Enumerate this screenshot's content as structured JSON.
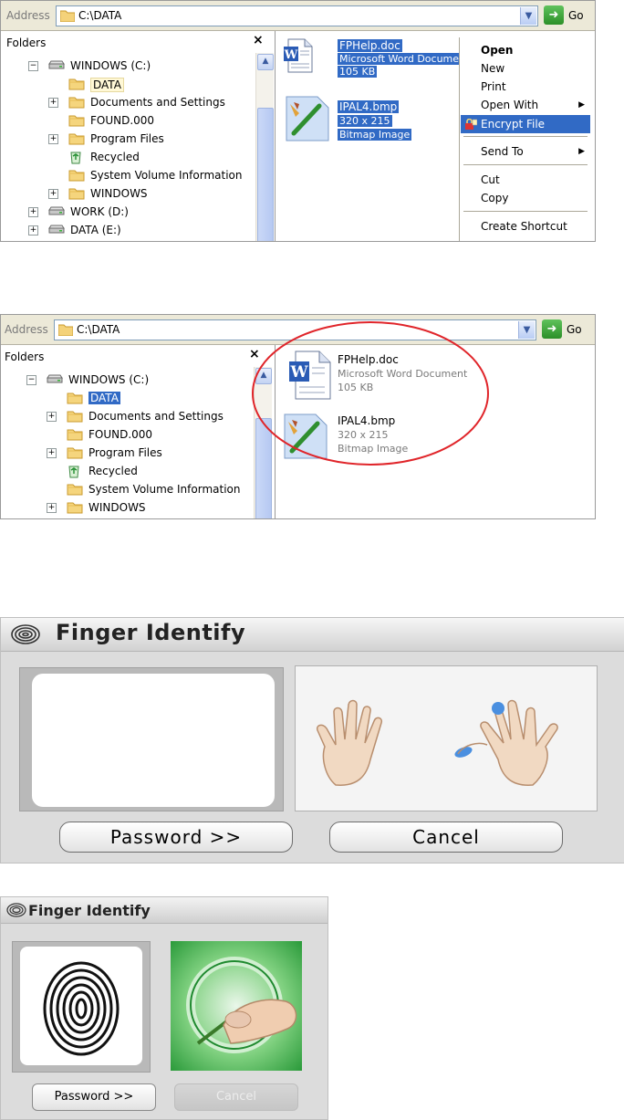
{
  "explorer_top": {
    "address_label": "Address",
    "address_value": "C:\\DATA",
    "go_label": "Go",
    "folders_title": "Folders",
    "close_glyph": "×",
    "tree": [
      {
        "label": "WINDOWS (C:)",
        "icon": "drive-icon",
        "expander": "−"
      },
      {
        "label": "DATA",
        "icon": "folder-icon",
        "expander": ""
      },
      {
        "label": "Documents and Settings",
        "icon": "folder-icon",
        "expander": "+"
      },
      {
        "label": "FOUND.000",
        "icon": "folder-icon",
        "expander": ""
      },
      {
        "label": "Program Files",
        "icon": "folder-icon",
        "expander": "+"
      },
      {
        "label": "Recycled",
        "icon": "recycle-icon",
        "expander": ""
      },
      {
        "label": "System Volume Information",
        "icon": "folder-icon",
        "expander": ""
      },
      {
        "label": "WINDOWS",
        "icon": "folder-icon",
        "expander": "+"
      },
      {
        "label": "WORK (D:)",
        "icon": "drive-icon",
        "expander": "+"
      },
      {
        "label": "DATA (E:)",
        "icon": "drive-icon",
        "expander": "+"
      }
    ],
    "files": [
      {
        "name": "FPHelp.doc",
        "type": "Microsoft Word Document",
        "size": "105 KB",
        "icon": "word-doc-icon"
      },
      {
        "name": "IPAL4.bmp",
        "type": "320 x 215",
        "size": "Bitmap Image",
        "icon": "bitmap-icon"
      }
    ],
    "context_menu": {
      "items": [
        "Open",
        "New",
        "Print",
        "Open With",
        "Encrypt File",
        "Send To",
        "Cut",
        "Copy",
        "Create Shortcut"
      ],
      "highlighted": "Encrypt File"
    }
  },
  "explorer_bottom": {
    "address_label": "Address",
    "address_value": "C:\\DATA",
    "go_label": "Go",
    "folders_title": "Folders",
    "close_glyph": "×",
    "tree": [
      {
        "label": "WINDOWS (C:)",
        "icon": "drive-icon",
        "expander": "−"
      },
      {
        "label": "DATA",
        "icon": "folder-icon",
        "expander": ""
      },
      {
        "label": "Documents and Settings",
        "icon": "folder-icon",
        "expander": "+"
      },
      {
        "label": "FOUND.000",
        "icon": "folder-icon",
        "expander": ""
      },
      {
        "label": "Program Files",
        "icon": "folder-icon",
        "expander": "+"
      },
      {
        "label": "Recycled",
        "icon": "recycle-icon",
        "expander": ""
      },
      {
        "label": "System Volume Information",
        "icon": "folder-icon",
        "expander": ""
      },
      {
        "label": "WINDOWS",
        "icon": "folder-icon",
        "expander": "+"
      }
    ],
    "files": [
      {
        "name": "FPHelp.doc",
        "type": "Microsoft Word Document",
        "size": "105 KB",
        "icon": "word-doc-icon"
      },
      {
        "name": "IPAL4.bmp",
        "type": "320 x 215",
        "size": "Bitmap Image",
        "icon": "bitmap-icon"
      }
    ]
  },
  "finger_identify_large": {
    "title": "Finger Identify",
    "password_button": "Password >>",
    "cancel_button": "Cancel"
  },
  "finger_identify_small": {
    "title": "Finger Identify",
    "password_button": "Password >>",
    "cancel_button": "Cancel"
  },
  "colors": {
    "selection": "#316ac5",
    "encrypted_circle": "#e0252a",
    "dialog_bg": "#dcdcdc"
  }
}
